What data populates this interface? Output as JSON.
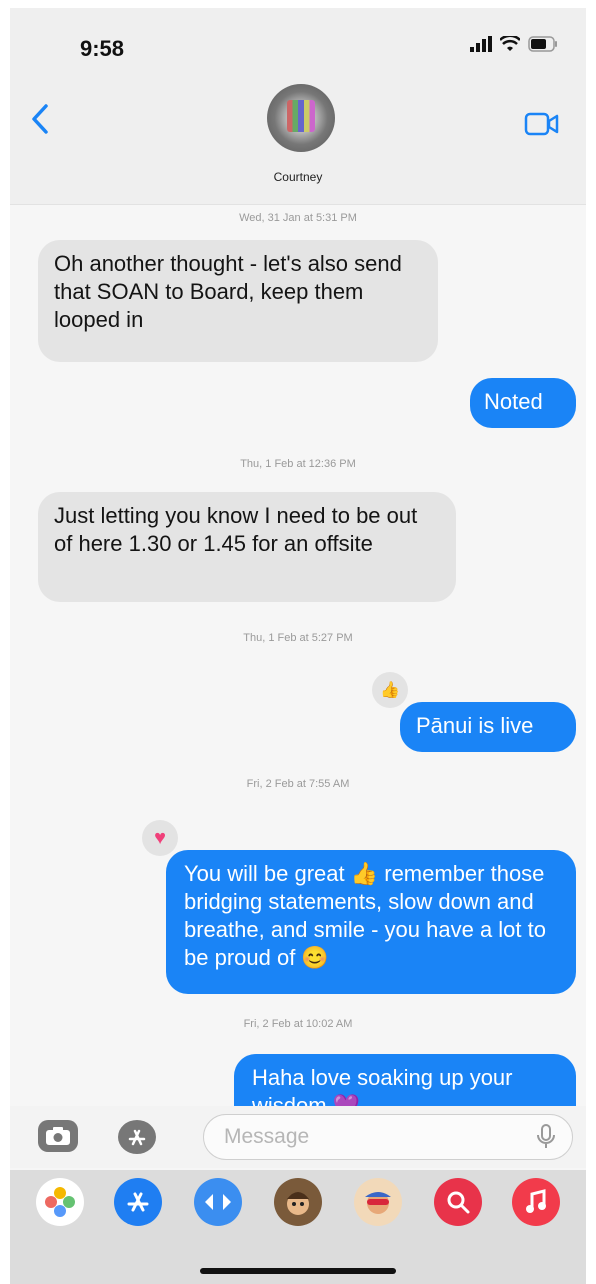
{
  "status": {
    "time": "9:58"
  },
  "header": {
    "contact_name": "Courtney"
  },
  "messages": [
    {
      "timestamp": "Wed, 31 Jan at 5:31 PM"
    },
    {
      "incoming_1": "Oh another thought - let's also send that SOAN to Board, keep them looped in"
    },
    {
      "outgoing_1": "Noted"
    },
    {
      "timestamp": "Thu, 1 Feb at 12:36 PM"
    },
    {
      "incoming_2": "Just letting you know I need to be out of here 1.30 or 1.45 for an offsite"
    },
    {
      "timestamp": "Thu, 1 Feb at 5:27 PM"
    },
    {
      "outgoing_2": "Pānui is live"
    },
    {
      "timestamp": "Fri, 2 Feb at 7:55 AM"
    },
    {
      "outgoing_3": "You will be great 👍 remember those bridging statements, slow down and breathe, and smile - you have a lot to be proud of 😊"
    },
    {
      "timestamp": "Fri, 2 Feb at 10:02 AM"
    },
    {
      "outgoing_4": "Haha love soaking up your wisdom 💜"
    }
  ],
  "thread": {
    "ts1": "Wed, 31 Jan at 5:31 PM",
    "m1": "Oh another thought - let's also send that SOAN to Board, keep them looped in",
    "m2": "Noted",
    "ts2": "Thu, 1 Feb at 12:36 PM",
    "m3": "Just letting you know I need to be out of here 1.30 or 1.45 for an offsite",
    "ts3": "Thu, 1 Feb at 5:27 PM",
    "m4": "Pānui is live",
    "m4_reaction": "👍",
    "ts4": "Fri, 2 Feb at 7:55 AM",
    "m5": "You will be great 👍 remember those bridging statements, slow down and breathe, and smile - you have a lot to be proud of 😊",
    "m5_reaction": "♥",
    "ts5": "Fri, 2 Feb at 10:02 AM",
    "m6": "Haha love soaking up your wisdom 💜"
  },
  "composer": {
    "placeholder": "Message"
  },
  "colors": {
    "outgoing": "#1a84f6",
    "incoming": "#e4e4e4",
    "accent": "#1a84f6",
    "heart": "#f0407a"
  },
  "app_drawer": [
    "photos-app",
    "app-store-app",
    "audio-app",
    "memoji-app",
    "memoji-stickers-app",
    "search-images-app",
    "music-app"
  ]
}
